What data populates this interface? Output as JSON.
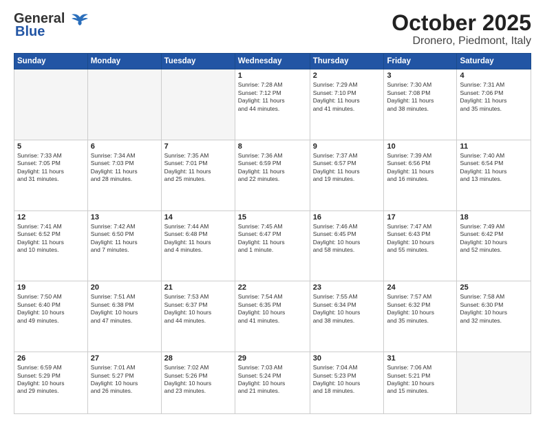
{
  "header": {
    "logo": {
      "line1": "General",
      "line2": "Blue"
    },
    "title": "October 2025",
    "subtitle": "Dronero, Piedmont, Italy"
  },
  "weekdays": [
    "Sunday",
    "Monday",
    "Tuesday",
    "Wednesday",
    "Thursday",
    "Friday",
    "Saturday"
  ],
  "weeks": [
    [
      {
        "day": "",
        "info": ""
      },
      {
        "day": "",
        "info": ""
      },
      {
        "day": "",
        "info": ""
      },
      {
        "day": "1",
        "info": "Sunrise: 7:28 AM\nSunset: 7:12 PM\nDaylight: 11 hours\nand 44 minutes."
      },
      {
        "day": "2",
        "info": "Sunrise: 7:29 AM\nSunset: 7:10 PM\nDaylight: 11 hours\nand 41 minutes."
      },
      {
        "day": "3",
        "info": "Sunrise: 7:30 AM\nSunset: 7:08 PM\nDaylight: 11 hours\nand 38 minutes."
      },
      {
        "day": "4",
        "info": "Sunrise: 7:31 AM\nSunset: 7:06 PM\nDaylight: 11 hours\nand 35 minutes."
      }
    ],
    [
      {
        "day": "5",
        "info": "Sunrise: 7:33 AM\nSunset: 7:05 PM\nDaylight: 11 hours\nand 31 minutes."
      },
      {
        "day": "6",
        "info": "Sunrise: 7:34 AM\nSunset: 7:03 PM\nDaylight: 11 hours\nand 28 minutes."
      },
      {
        "day": "7",
        "info": "Sunrise: 7:35 AM\nSunset: 7:01 PM\nDaylight: 11 hours\nand 25 minutes."
      },
      {
        "day": "8",
        "info": "Sunrise: 7:36 AM\nSunset: 6:59 PM\nDaylight: 11 hours\nand 22 minutes."
      },
      {
        "day": "9",
        "info": "Sunrise: 7:37 AM\nSunset: 6:57 PM\nDaylight: 11 hours\nand 19 minutes."
      },
      {
        "day": "10",
        "info": "Sunrise: 7:39 AM\nSunset: 6:56 PM\nDaylight: 11 hours\nand 16 minutes."
      },
      {
        "day": "11",
        "info": "Sunrise: 7:40 AM\nSunset: 6:54 PM\nDaylight: 11 hours\nand 13 minutes."
      }
    ],
    [
      {
        "day": "12",
        "info": "Sunrise: 7:41 AM\nSunset: 6:52 PM\nDaylight: 11 hours\nand 10 minutes."
      },
      {
        "day": "13",
        "info": "Sunrise: 7:42 AM\nSunset: 6:50 PM\nDaylight: 11 hours\nand 7 minutes."
      },
      {
        "day": "14",
        "info": "Sunrise: 7:44 AM\nSunset: 6:48 PM\nDaylight: 11 hours\nand 4 minutes."
      },
      {
        "day": "15",
        "info": "Sunrise: 7:45 AM\nSunset: 6:47 PM\nDaylight: 11 hours\nand 1 minute."
      },
      {
        "day": "16",
        "info": "Sunrise: 7:46 AM\nSunset: 6:45 PM\nDaylight: 10 hours\nand 58 minutes."
      },
      {
        "day": "17",
        "info": "Sunrise: 7:47 AM\nSunset: 6:43 PM\nDaylight: 10 hours\nand 55 minutes."
      },
      {
        "day": "18",
        "info": "Sunrise: 7:49 AM\nSunset: 6:42 PM\nDaylight: 10 hours\nand 52 minutes."
      }
    ],
    [
      {
        "day": "19",
        "info": "Sunrise: 7:50 AM\nSunset: 6:40 PM\nDaylight: 10 hours\nand 49 minutes."
      },
      {
        "day": "20",
        "info": "Sunrise: 7:51 AM\nSunset: 6:38 PM\nDaylight: 10 hours\nand 47 minutes."
      },
      {
        "day": "21",
        "info": "Sunrise: 7:53 AM\nSunset: 6:37 PM\nDaylight: 10 hours\nand 44 minutes."
      },
      {
        "day": "22",
        "info": "Sunrise: 7:54 AM\nSunset: 6:35 PM\nDaylight: 10 hours\nand 41 minutes."
      },
      {
        "day": "23",
        "info": "Sunrise: 7:55 AM\nSunset: 6:34 PM\nDaylight: 10 hours\nand 38 minutes."
      },
      {
        "day": "24",
        "info": "Sunrise: 7:57 AM\nSunset: 6:32 PM\nDaylight: 10 hours\nand 35 minutes."
      },
      {
        "day": "25",
        "info": "Sunrise: 7:58 AM\nSunset: 6:30 PM\nDaylight: 10 hours\nand 32 minutes."
      }
    ],
    [
      {
        "day": "26",
        "info": "Sunrise: 6:59 AM\nSunset: 5:29 PM\nDaylight: 10 hours\nand 29 minutes."
      },
      {
        "day": "27",
        "info": "Sunrise: 7:01 AM\nSunset: 5:27 PM\nDaylight: 10 hours\nand 26 minutes."
      },
      {
        "day": "28",
        "info": "Sunrise: 7:02 AM\nSunset: 5:26 PM\nDaylight: 10 hours\nand 23 minutes."
      },
      {
        "day": "29",
        "info": "Sunrise: 7:03 AM\nSunset: 5:24 PM\nDaylight: 10 hours\nand 21 minutes."
      },
      {
        "day": "30",
        "info": "Sunrise: 7:04 AM\nSunset: 5:23 PM\nDaylight: 10 hours\nand 18 minutes."
      },
      {
        "day": "31",
        "info": "Sunrise: 7:06 AM\nSunset: 5:21 PM\nDaylight: 10 hours\nand 15 minutes."
      },
      {
        "day": "",
        "info": ""
      }
    ]
  ]
}
